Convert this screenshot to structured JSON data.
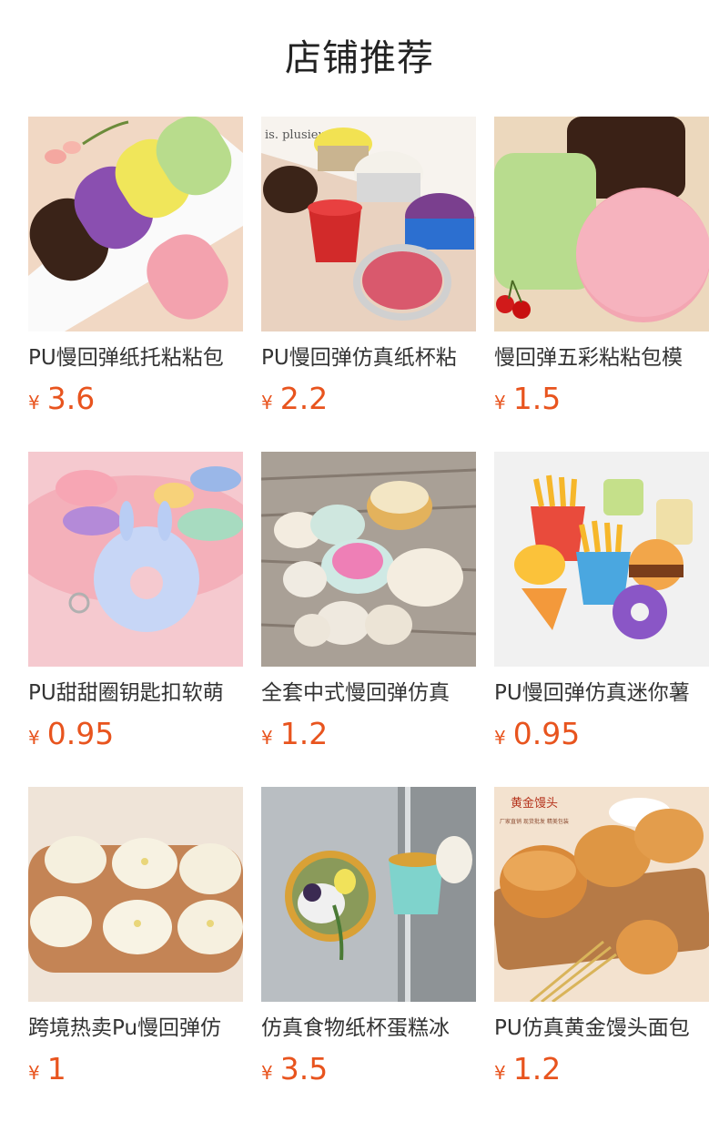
{
  "page": {
    "title": "店铺推荐"
  },
  "currency_symbol": "¥",
  "products": [
    {
      "name": "PU慢回弹纸托粘粘包",
      "price": "3.6",
      "image": "long-cakes-image"
    },
    {
      "name": "PU慢回弹仿真纸杯粘",
      "price": "2.2",
      "image": "cup-cakes-image"
    },
    {
      "name": "慢回弹五彩粘粘包模",
      "price": "1.5",
      "image": "square-cakes-image"
    },
    {
      "name": "PU甜甜圈钥匙扣软萌",
      "price": "0.95",
      "image": "donut-keychains-image"
    },
    {
      "name": "全套中式慢回弹仿真",
      "price": "1.2",
      "image": "dim-sum-image"
    },
    {
      "name": "PU慢回弹仿真迷你薯",
      "price": "0.95",
      "image": "fast-food-image"
    },
    {
      "name": "跨境热卖Pu慢回弹仿",
      "price": "1",
      "image": "steamed-buns-image"
    },
    {
      "name": "仿真食物纸杯蛋糕冰",
      "price": "3.5",
      "image": "cupcake-magnet-image"
    },
    {
      "name": "PU仿真黄金馒头面包",
      "price": "1.2",
      "image": "golden-buns-image"
    }
  ],
  "image_texts": {
    "golden_buns_banner": "黄金馒头",
    "golden_buns_tags": "厂家直销  现货批发  精美包装",
    "cup_cakes_backdrop": "is. plusieurs fo"
  }
}
